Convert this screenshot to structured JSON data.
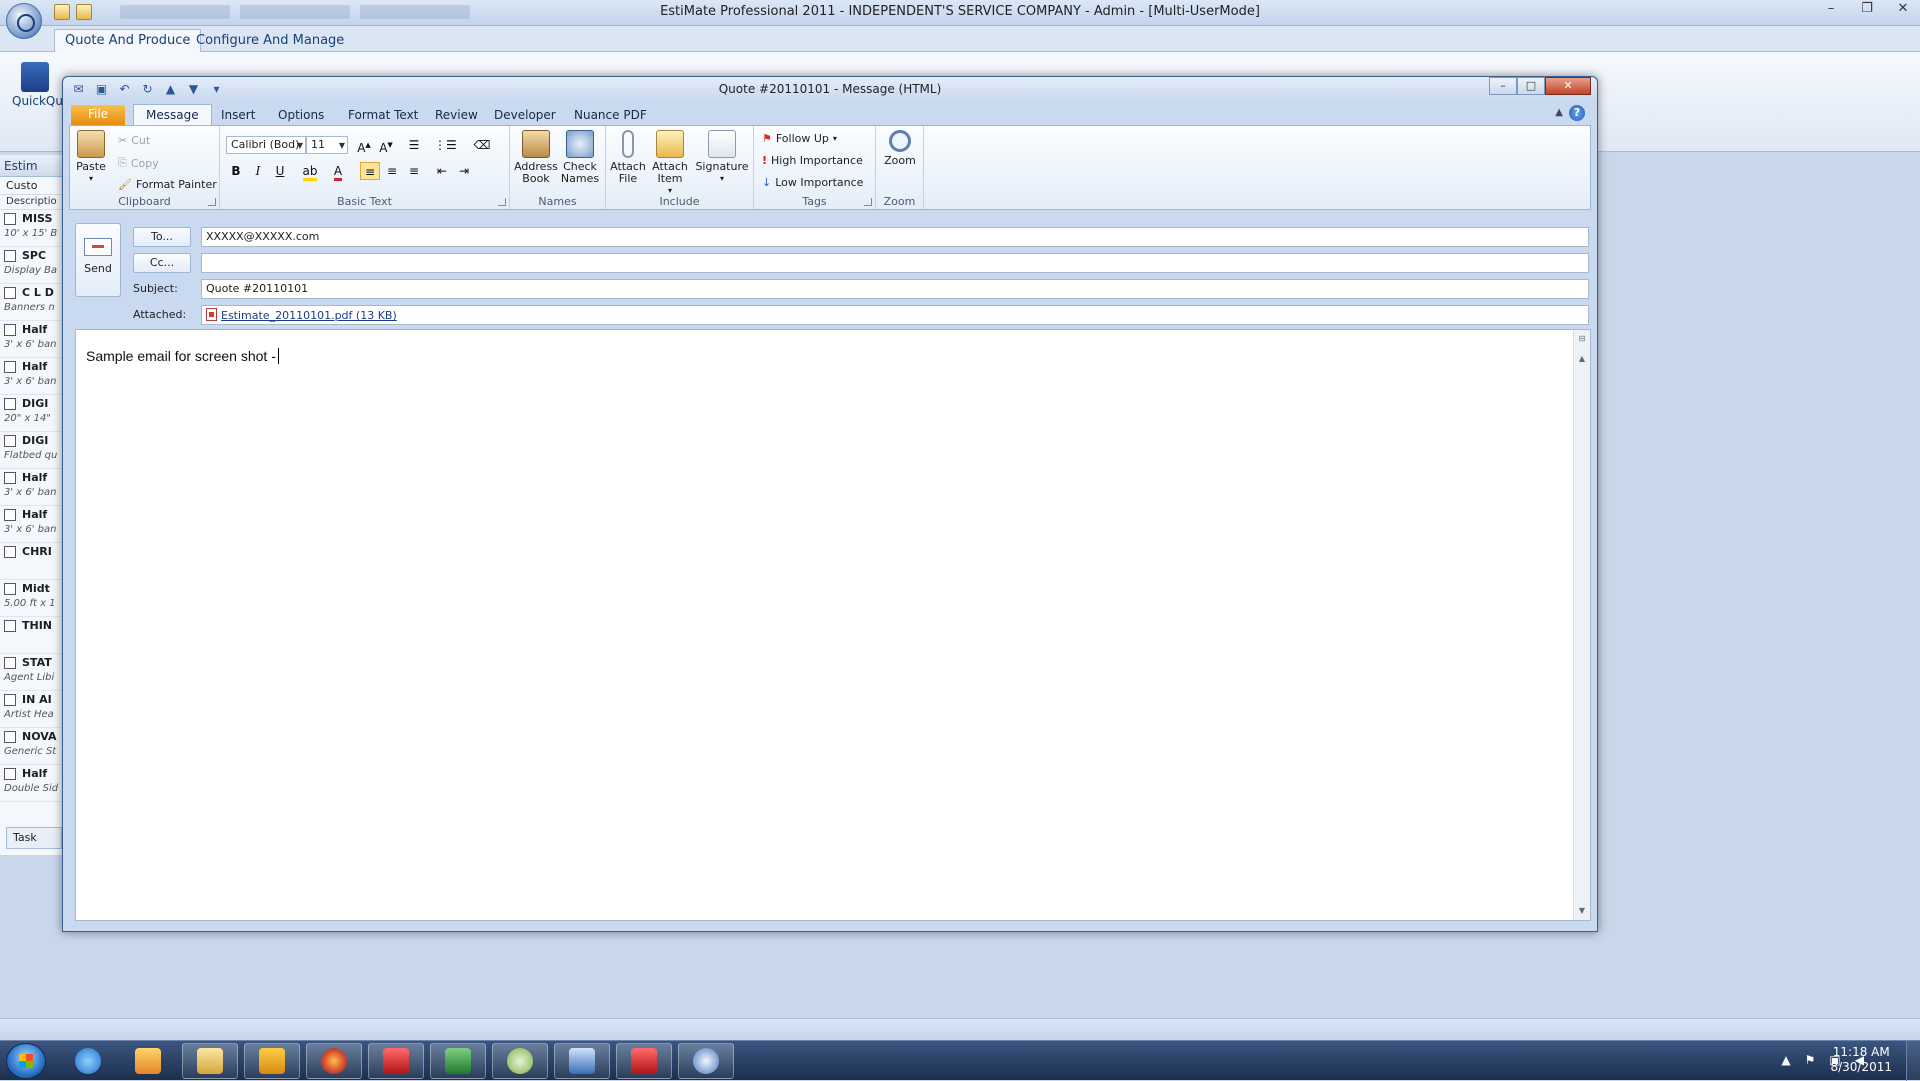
{
  "background_app": {
    "title": "EstiMate Professional 2011 - INDEPENDENT'S SERVICE COMPANY - Admin - [Multi-UserMode]",
    "tabs": [
      "Quote And Produce",
      "Configure And Manage"
    ],
    "quickquote_label": "QuickQu",
    "sidebar": {
      "header": "Estim",
      "customer_label": "Custo",
      "description_label": "Descriptio",
      "jobs": [
        {
          "title": "MISS",
          "subtitle": "10' x 15' B"
        },
        {
          "title": "SPC",
          "subtitle": "Display Ba"
        },
        {
          "title": "C L D",
          "subtitle": "Banners n"
        },
        {
          "title": "Half",
          "subtitle": "3' x 6' ban"
        },
        {
          "title": "Half",
          "subtitle": "3' x 6' ban"
        },
        {
          "title": "DIGI",
          "subtitle": "20\" x 14\""
        },
        {
          "title": "DIGI",
          "subtitle": "Flatbed qu"
        },
        {
          "title": "Half",
          "subtitle": "3' x 6' ban"
        },
        {
          "title": "Half",
          "subtitle": "3' x 6' ban"
        },
        {
          "title": "CHRI",
          "subtitle": ""
        },
        {
          "title": "Midt",
          "subtitle": "5.00 ft x 1"
        },
        {
          "title": "THIN",
          "subtitle": ""
        },
        {
          "title": "STAT",
          "subtitle": "Agent Libi"
        },
        {
          "title": "IN AI",
          "subtitle": "Artist Hea"
        },
        {
          "title": "NOVA",
          "subtitle": "Generic St"
        },
        {
          "title": "Half",
          "subtitle": "Double Sid"
        }
      ],
      "task_label": "Task"
    }
  },
  "message_window": {
    "title": "Quote #20110101  -  Message (HTML)",
    "ribbon_tabs": [
      "File",
      "Message",
      "Insert",
      "Options",
      "Format Text",
      "Review",
      "Developer",
      "Nuance PDF"
    ],
    "active_tab": "Message",
    "clipboard": {
      "paste": "Paste",
      "cut": "Cut",
      "copy": "Copy",
      "format_painter": "Format Painter",
      "group_label": "Clipboard"
    },
    "basic_text": {
      "font_name": "Calibri (Bod)",
      "font_size": "11",
      "grow": "A",
      "shrink": "A",
      "bold": "B",
      "italic": "I",
      "underline": "U",
      "group_label": "Basic Text"
    },
    "names": {
      "address_book": "Address Book",
      "check_names": "Check Names",
      "group_label": "Names"
    },
    "include": {
      "attach_file": "Attach File",
      "attach_item": "Attach Item",
      "signature": "Signature",
      "group_label": "Include"
    },
    "tags": {
      "follow_up": "Follow Up",
      "high_importance": "High Importance",
      "low_importance": "Low Importance",
      "group_label": "Tags"
    },
    "zoom": {
      "zoom": "Zoom",
      "group_label": "Zoom"
    },
    "send_label": "Send",
    "to_button": "To...",
    "cc_button": "Cc...",
    "to_value": "XXXXX@XXXXX.com",
    "cc_value": "",
    "subject_label": "Subject:",
    "subject_value": "Quote #20110101",
    "attached_label": "Attached:",
    "attachment_name": "Estimate_20110101.pdf (13 KB)",
    "body_text": "Sample email for screen shot -"
  },
  "taskbar": {
    "items": [
      "start",
      "internet-explorer",
      "media-player",
      "windows-explorer",
      "outlook",
      "firefox",
      "adobe-acrobat",
      "excel",
      "google-talk",
      "remote-desktop",
      "adobe-acrobat-2",
      "estimate"
    ],
    "clock_time": "11:18 AM",
    "clock_date": "8/30/2011"
  }
}
